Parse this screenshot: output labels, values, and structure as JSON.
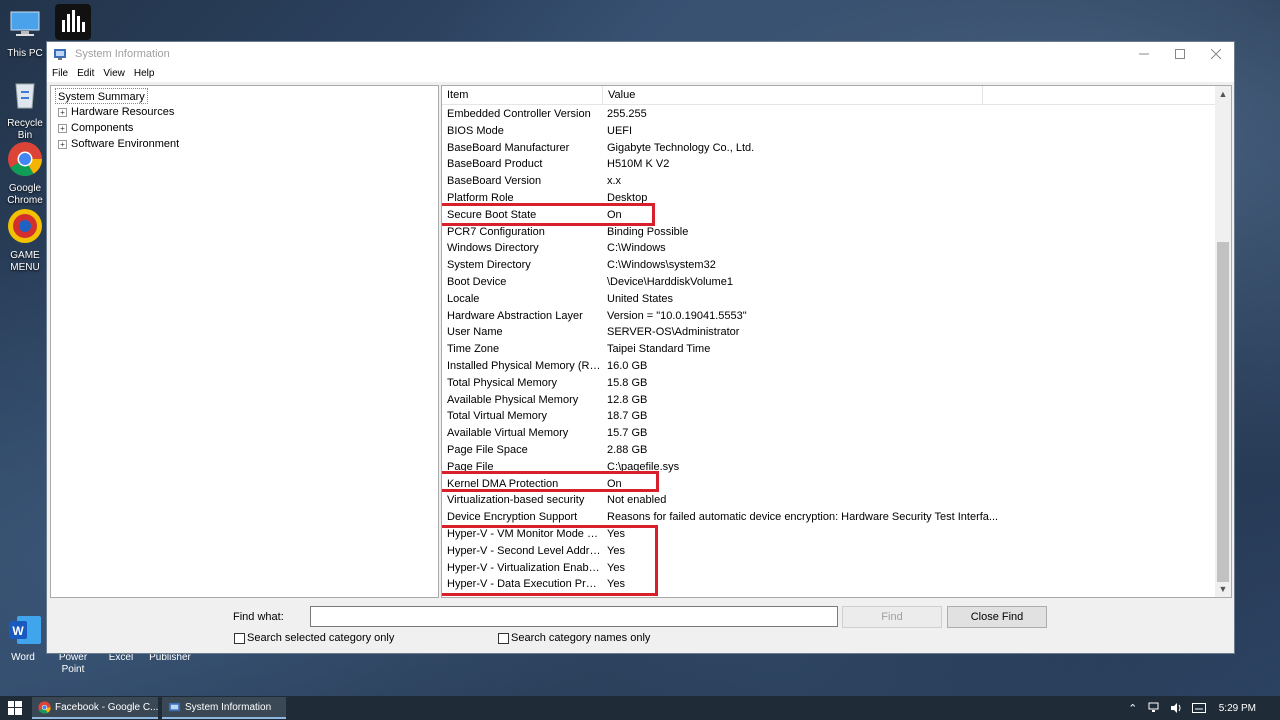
{
  "desktop": {
    "icons": [
      {
        "label": "This PC"
      },
      {
        "label": "Recycle\nBin"
      },
      {
        "label": "Google\nChrome"
      },
      {
        "label": "GAME\nMENU"
      },
      {
        "label": "Word"
      },
      {
        "label": "Power\nPoint"
      },
      {
        "label": "Excel"
      },
      {
        "label": "Publisher"
      }
    ]
  },
  "window": {
    "title": "System Information",
    "menu": [
      "File",
      "Edit",
      "View",
      "Help"
    ]
  },
  "tree": {
    "root": "System Summary",
    "children": [
      "Hardware Resources",
      "Components",
      "Software Environment"
    ]
  },
  "list": {
    "headers": {
      "item": "Item",
      "value": "Value"
    },
    "rows": [
      {
        "item": "Embedded Controller Version",
        "value": "255.255"
      },
      {
        "item": "BIOS Mode",
        "value": "UEFI"
      },
      {
        "item": "BaseBoard Manufacturer",
        "value": "Gigabyte Technology Co., Ltd."
      },
      {
        "item": "BaseBoard Product",
        "value": "H510M K V2"
      },
      {
        "item": "BaseBoard Version",
        "value": "x.x"
      },
      {
        "item": "Platform Role",
        "value": "Desktop"
      },
      {
        "item": "Secure Boot State",
        "value": "On"
      },
      {
        "item": "PCR7 Configuration",
        "value": "Binding Possible"
      },
      {
        "item": "Windows Directory",
        "value": "C:\\Windows"
      },
      {
        "item": "System Directory",
        "value": "C:\\Windows\\system32"
      },
      {
        "item": "Boot Device",
        "value": "\\Device\\HarddiskVolume1"
      },
      {
        "item": "Locale",
        "value": "United States"
      },
      {
        "item": "Hardware Abstraction Layer",
        "value": "Version = \"10.0.19041.5553\""
      },
      {
        "item": "User Name",
        "value": "SERVER-OS\\Administrator"
      },
      {
        "item": "Time Zone",
        "value": "Taipei Standard Time"
      },
      {
        "item": "Installed Physical Memory (RAM)",
        "value": "16.0 GB"
      },
      {
        "item": "Total Physical Memory",
        "value": "15.8 GB"
      },
      {
        "item": "Available Physical Memory",
        "value": "12.8 GB"
      },
      {
        "item": "Total Virtual Memory",
        "value": "18.7 GB"
      },
      {
        "item": "Available Virtual Memory",
        "value": "15.7 GB"
      },
      {
        "item": "Page File Space",
        "value": "2.88 GB"
      },
      {
        "item": "Page File",
        "value": "C:\\pagefile.sys"
      },
      {
        "item": "Kernel DMA Protection",
        "value": "On"
      },
      {
        "item": "Virtualization-based security",
        "value": "Not enabled"
      },
      {
        "item": "Device Encryption Support",
        "value": "Reasons for failed automatic device encryption: Hardware Security Test Interfa..."
      },
      {
        "item": "Hyper-V - VM Monitor Mode E...",
        "value": "Yes"
      },
      {
        "item": "Hyper-V - Second Level Addres...",
        "value": "Yes"
      },
      {
        "item": "Hyper-V - Virtualization Enable...",
        "value": "Yes"
      },
      {
        "item": "Hyper-V - Data Execution Prote...",
        "value": "Yes"
      }
    ]
  },
  "find": {
    "label": "Find what:",
    "value": "",
    "find_button": "Find",
    "close_button": "Close Find",
    "opt_selected": "Search selected category only",
    "opt_names": "Search category names only"
  },
  "taskbar": {
    "tasks": [
      "Facebook - Google C...",
      "System Information"
    ],
    "time": "5:29 PM"
  },
  "colors": {
    "highlight": "#d8202a",
    "titlebar": "#ffffff"
  }
}
